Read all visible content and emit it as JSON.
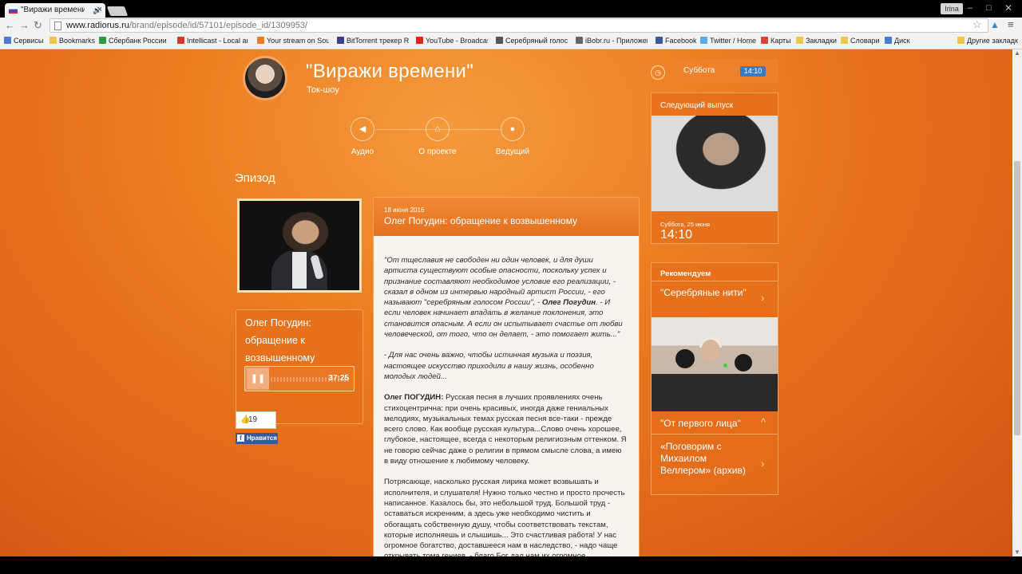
{
  "browser": {
    "tab": {
      "title": "\"Виражи времени\" / Ок"
    },
    "profile": "Irina",
    "address": {
      "host": "www.radiorus.ru",
      "path": "/brand/episode/id/57101/episode_id/1309953/"
    },
    "bookmarks": [
      {
        "label": "Сервисы",
        "color": "#4a7bd0"
      },
      {
        "label": "Bookmarks",
        "color": "#f0c64a"
      },
      {
        "label": "Сбербанк России :: Г",
        "color": "#2e9c3f"
      },
      {
        "label": "Intellicast - Local and",
        "color": "#d33a2c"
      },
      {
        "label": "Your stream on Sounc",
        "color": "#f27a1a"
      },
      {
        "label": "BitTorrent трекер RuT",
        "color": "#3e3e8e"
      },
      {
        "label": "YouTube - Broadcast",
        "color": "#e62117"
      },
      {
        "label": "Серебряный голос Р",
        "color": "#555555"
      },
      {
        "label": "iBobr.ru - Приложени",
        "color": "#666666"
      },
      {
        "label": "Facebook",
        "color": "#3b5998"
      },
      {
        "label": "Twitter / Home",
        "color": "#55acee"
      },
      {
        "label": "Карты",
        "color": "#db4437"
      },
      {
        "label": "Закладки",
        "color": "#f0c64a"
      },
      {
        "label": "Словари",
        "color": "#f0c64a"
      },
      {
        "label": "Диск",
        "color": "#4a7bd0"
      },
      {
        "label": "Другие закладки",
        "color": "#f0c64a"
      }
    ]
  },
  "show": {
    "title": "\"Виражи времени\"",
    "subtitle": "Ток-шоу"
  },
  "nav": [
    {
      "label": "Аудио",
      "icon": "speaker-icon"
    },
    {
      "label": "О проекте",
      "icon": "home-icon"
    },
    {
      "label": "Ведущий",
      "icon": "person-icon"
    }
  ],
  "section_title": "Эпизод",
  "player": {
    "title": "Олег Погудин: обращение к возвышенному",
    "time": "37:25"
  },
  "likes": {
    "count": "19",
    "fb_label": "Нравится"
  },
  "article": {
    "date": "18 июня 2016",
    "title": "Олег Погудин: обращение к возвышенному",
    "quote_start": "\"От тщеславия не свободен ни один человек, и для души артиста существуют особые опасности, поскольку успех и признание составляют необходимое условие его реализации, - сказал в одном из интервью народный артист России, - его называют \"серебряным голосом России\", - ",
    "quote_name": "Олег Погудин",
    "quote_end": ". - И если человек начинает впадать в желание поклонения, это становится опасным. А если он испытывает счастье от любви человеческой, от того, что он делает, - это помогает жить...\"",
    "quote2": "- Для нас очень важно, чтобы истинная музыка и поэзия, настоящее искусство приходили в нашу жизнь, особенно молодых людей...",
    "speaker": "Олег ПОГУДИН:",
    "para1": "  Русская песня в лучших проявлениях очень стихоцентрична: при очень красивых, иногда даже гениальных мелодиях, музыкальных темах русская песня все-таки - прежде всего слово. Как вообще русская культура...Слово очень хорошее, глубокое, настоящее, всегда с некоторым религиозным оттенком. Я не говорю сейчас даже о религии в прямом смысле слова, а имею в виду отношение к любимому человеку.",
    "para2": "Потрясающе, насколько русская лирика может возвышать и исполнителя, и слушателя! Нужно только честно и просто прочесть написанное. Казалось бы, это небольшой труд. Большой труд - оставаться искренним, а здесь уже необходимо чистить и обогащать собственную душу, чтобы соответствовать текстам, которые исполняешь и слышишь... Это счастливая работа! У нас огромное богатство, доставшееся нам в наследство, - надо чаще открывать тома гениев, - благо Бог дал нам их огромное количество."
  },
  "schedule": {
    "day": "Суббота",
    "time": "14:10"
  },
  "next": {
    "heading": "Следующий выпуск",
    "date": "Суббота, 25 июня",
    "time": "14:10"
  },
  "recommend": {
    "heading": "Рекомендуем",
    "items": [
      "\"Серебряные нити\"",
      "\"От первого лица\"",
      "«Поговорим с Михаилом Веллером» (архив)"
    ]
  }
}
